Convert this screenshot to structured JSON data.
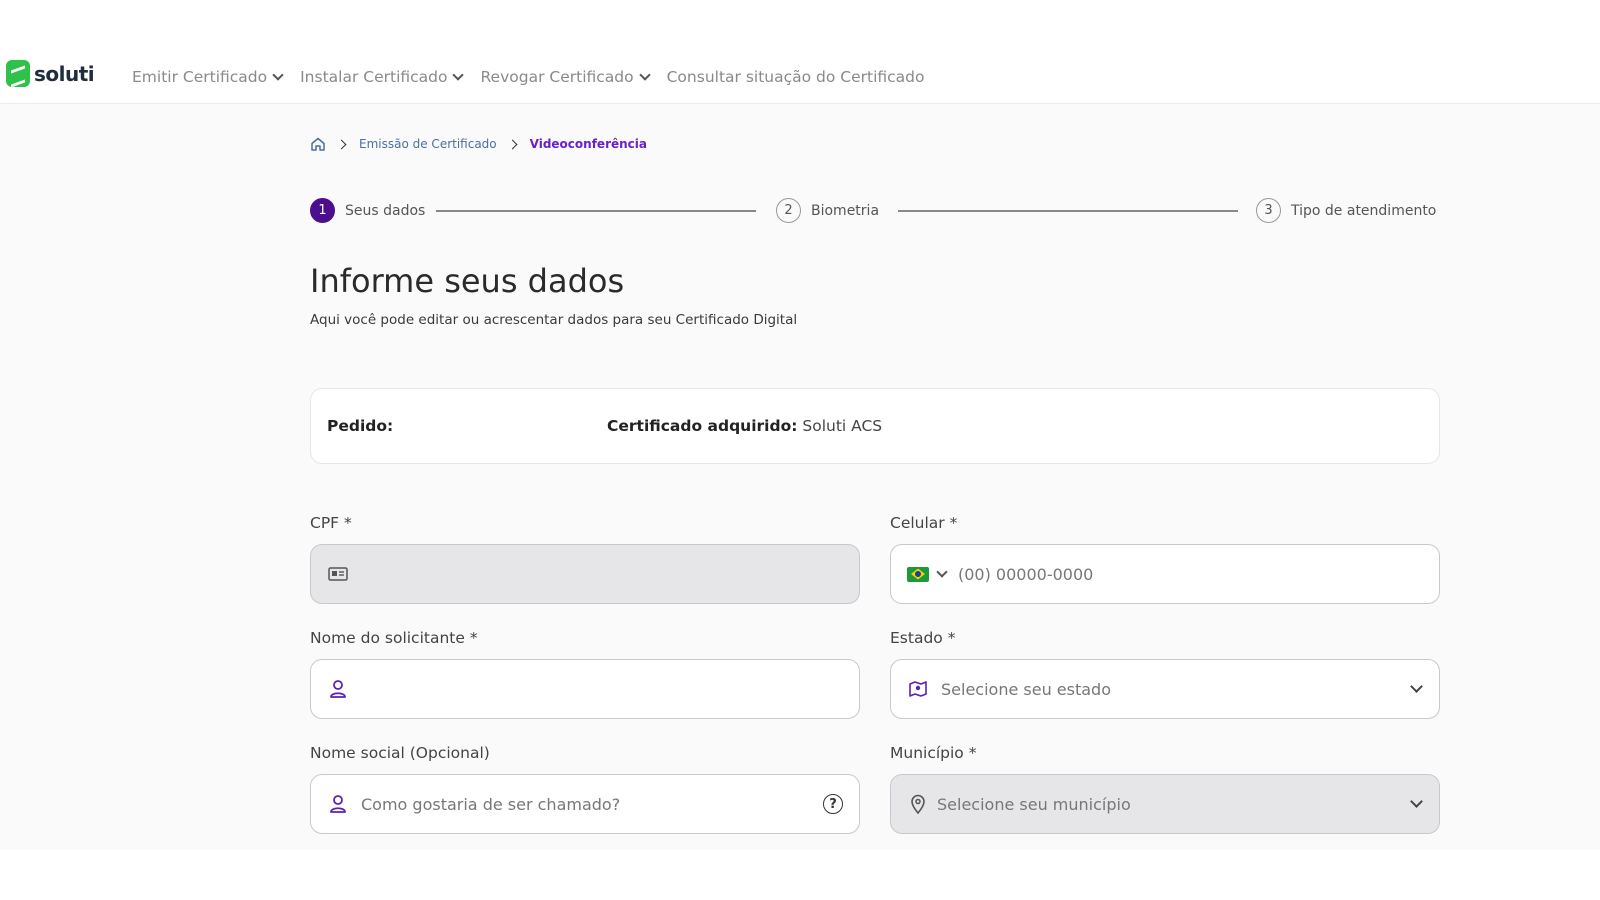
{
  "brand": {
    "name": "soluti",
    "color": "#2ec24a"
  },
  "nav": {
    "items": [
      {
        "label": "Emitir Certificado",
        "dropdown": true
      },
      {
        "label": "Instalar Certificado",
        "dropdown": true
      },
      {
        "label": "Revogar Certificado",
        "dropdown": true
      },
      {
        "label": "Consultar situação do Certificado",
        "dropdown": false
      }
    ]
  },
  "breadcrumb": {
    "home_icon": "home-icon",
    "link": "Emissão de Certificado",
    "current": "Videoconferência"
  },
  "stepper": {
    "steps": [
      {
        "number": "1",
        "label": "Seus dados",
        "active": true
      },
      {
        "number": "2",
        "label": "Biometria",
        "active": false
      },
      {
        "number": "3",
        "label": "Tipo de atendimento",
        "active": false
      }
    ],
    "active_color": "#4b0f8e"
  },
  "page": {
    "title": "Informe seus dados",
    "subtitle": "Aqui você pode editar ou acrescentar dados para seu Certificado Digital"
  },
  "order": {
    "label": "Pedido:",
    "certificate_label": "Certificado adquirido:",
    "certificate_value": "Soluti ACS"
  },
  "form": {
    "cpf": {
      "label": "CPF *",
      "value": "",
      "disabled": true,
      "icon": "id-card-icon"
    },
    "celular": {
      "label": "Celular *",
      "placeholder": "(00) 00000-0000",
      "icon": "brazil-flag-icon"
    },
    "nome": {
      "label": "Nome do solicitante *",
      "value": "",
      "icon": "user-icon"
    },
    "estado": {
      "label": "Estado *",
      "placeholder": "Selecione seu estado",
      "icon": "map-icon"
    },
    "nome_social": {
      "label": "Nome social (Opcional)",
      "placeholder": "Como gostaria de ser chamado?",
      "icon": "user-icon",
      "help": "?"
    },
    "municipio": {
      "label": "Município *",
      "placeholder": "Selecione seu município",
      "disabled": true,
      "icon": "location-pin-icon"
    }
  },
  "colors": {
    "accent": "#6a1fc8",
    "icon_purple": "#5b21b6"
  }
}
